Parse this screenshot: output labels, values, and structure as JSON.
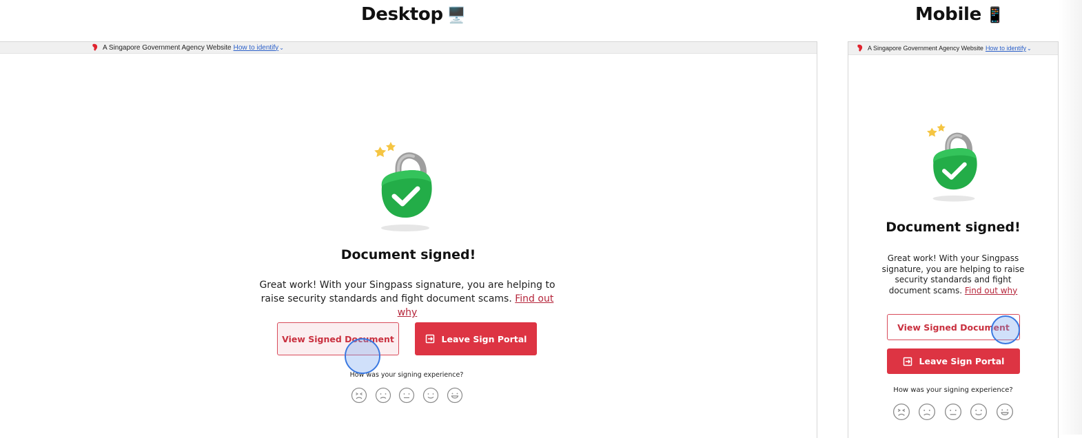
{
  "headings": {
    "desktop": "Desktop",
    "desktop_emoji": "🖥️",
    "mobile": "Mobile",
    "mobile_emoji": "📱"
  },
  "gov_banner": {
    "text": "A Singapore Government Agency Website",
    "link": "How to identify"
  },
  "page": {
    "title": "Document signed!",
    "message": "Great work! With your Singpass signature, you are helping to raise security standards and fight document scams.",
    "find_out_link": "Find out why",
    "view_button": "View Signed Document",
    "leave_button": "Leave Sign Portal",
    "rating_question": "How was your signing experience?",
    "ratings": [
      "very-unhappy",
      "unhappy",
      "neutral",
      "happy",
      "very-happy"
    ]
  },
  "colors": {
    "brand_red": "#dd3443",
    "lock_green": "#2bb34a",
    "link_blue": "#2a5fc9"
  }
}
